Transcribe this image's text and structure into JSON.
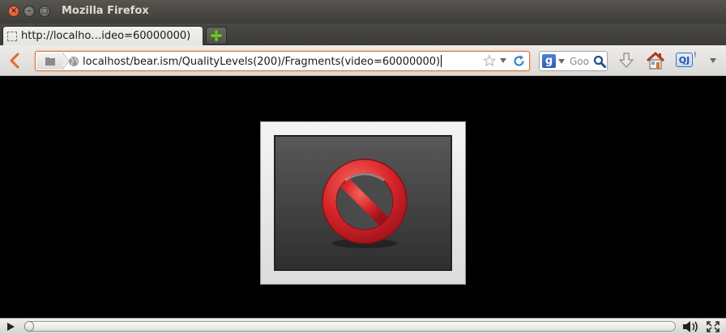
{
  "window": {
    "title": "Mozilla Firefox",
    "close_glyph": "×",
    "minimize_glyph": "–",
    "maximize_glyph": "□"
  },
  "tabs": [
    {
      "label": "http://localho…ideo=60000000)",
      "favicon": "blank-page-icon",
      "active": true
    }
  ],
  "new_tab": {
    "icon": "plus-icon",
    "color": "#6db42f"
  },
  "navbar": {
    "back_icon": "back-arrow-icon",
    "url": "localhost/bear.ism/QualityLevels(200)/Fragments(video=60000000)",
    "site_icon": "globe-icon",
    "bookmark_icon": "star-icon",
    "history_dropdown_icon": "chevron-down-icon",
    "reload_icon": "reload-icon",
    "search": {
      "engine_letter": "g",
      "engine_icon": "google-icon",
      "placeholder": "Goo",
      "icon": "magnifier-icon"
    },
    "download_icon": "download-arrow-icon",
    "home_icon": "home-icon",
    "addon_label": "QJ",
    "addon_badge": "!",
    "menu_icon": "chevron-down-icon"
  },
  "content": {
    "plugin_state": "blocked",
    "blocked_icon": "no-entry-icon",
    "accent_color": "#d8262b"
  },
  "media_controls": {
    "play_icon": "play-icon",
    "progress": 0,
    "volume_icon": "speaker-icon",
    "fullscreen_icon": "fullscreen-icon"
  }
}
